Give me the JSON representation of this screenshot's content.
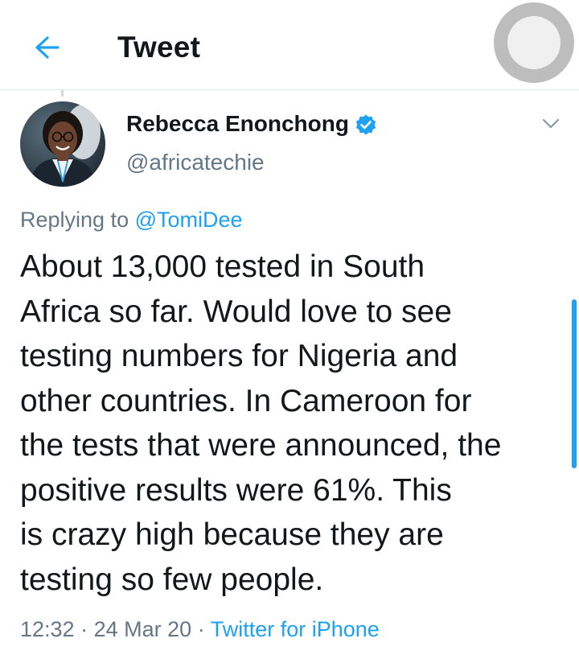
{
  "header": {
    "title": "Tweet",
    "back_icon": "arrow-left-icon",
    "accent_color": "#1da1f2"
  },
  "tweet": {
    "author": {
      "name": "Rebecca Enonchong",
      "handle": "@africatechie",
      "verified": true,
      "verified_icon": "verified-badge-icon"
    },
    "reply": {
      "prefix": "Replying to",
      "mention": "@TomiDee"
    },
    "text_lines": [
      "About 13,000 tested in South",
      "Africa so far. Would love to see",
      "testing numbers for Nigeria and",
      "other countries. In Cameroon for",
      "the tests that were announced, the",
      "positive results were 61%. This",
      "is crazy high because they are",
      "testing so few people."
    ],
    "meta": {
      "time": "12:32",
      "separator": "·",
      "date": "24 Mar 20",
      "source": "Twitter for iPhone"
    }
  },
  "colors": {
    "text": "#14171a",
    "secondary": "#657786",
    "link": "#1da1f2",
    "divider": "#e1e8ed"
  }
}
